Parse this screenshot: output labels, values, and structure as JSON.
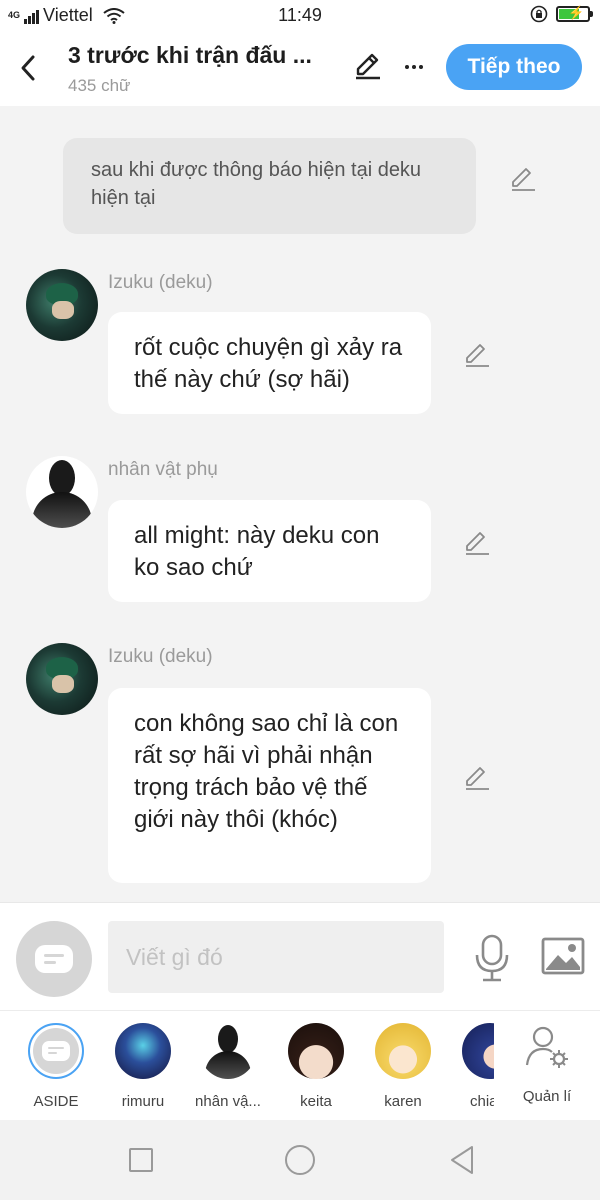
{
  "status_bar": {
    "network": "4G",
    "carrier": "Viettel",
    "time": "11:49",
    "battery_level": 0.7
  },
  "header": {
    "title": "3 trước khi trận đấu ...",
    "word_count": "435 chữ",
    "next_label": "Tiếp theo",
    "icons": [
      "back-icon",
      "pencil-icon",
      "more-icon"
    ]
  },
  "messages": [
    {
      "type": "aside",
      "text": "sau khi được thông báo hiện tại deku hiện tại"
    },
    {
      "type": "character",
      "speaker": "Izuku (deku)",
      "avatar": "deku",
      "text": "rốt cuộc chuyện gì xảy ra thế này chứ (sợ hãi)"
    },
    {
      "type": "character",
      "speaker": "nhân vật phụ",
      "avatar": "shadow",
      "text": "all might: này deku con ko sao chứ"
    },
    {
      "type": "character",
      "speaker": "Izuku (deku)",
      "avatar": "deku",
      "text": "con không sao chỉ là con rất sợ hãi vì phải nhận trọng trách bảo vệ thế giới này thôi (khóc)"
    }
  ],
  "composer": {
    "placeholder": "Viết gì đó",
    "icons": [
      "aside-chat-icon",
      "microphone-icon",
      "image-icon"
    ]
  },
  "characters": [
    {
      "name": "ASIDE",
      "selected": true
    },
    {
      "name": "rimuru"
    },
    {
      "name": "nhân vậ..."
    },
    {
      "name": "keita"
    },
    {
      "name": "karen"
    },
    {
      "name": "chia"
    }
  ],
  "manage_label": "Quản lí",
  "colors": {
    "accent": "#4aa3f4",
    "background": "#f3f3f3",
    "bubble": "#ffffff",
    "aside_bubble": "#e6e6e6"
  }
}
